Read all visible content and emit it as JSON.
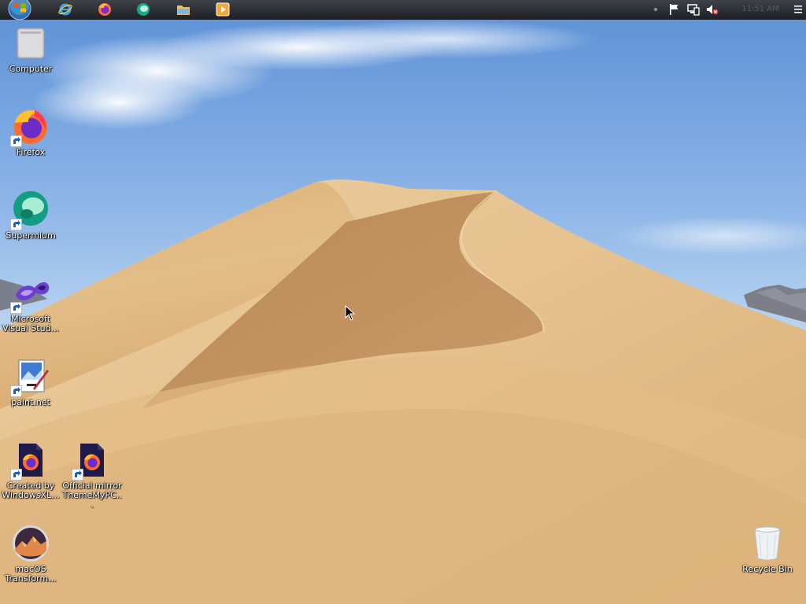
{
  "colors": {
    "sky_top": "#5f93d8",
    "sky_bottom": "#cfe3f4",
    "sand_light": "#e8c99a",
    "sand_mid": "#d4a66c",
    "sand_shadow": "#b8864d",
    "taskbar": "#2b2d33"
  },
  "taskbar": {
    "start_icon": "windows-logo-icon",
    "pinned": [
      {
        "name": "internet-explorer",
        "icon": "internet-explorer-icon"
      },
      {
        "name": "firefox",
        "icon": "firefox-icon"
      },
      {
        "name": "supermium",
        "icon": "supermium-icon"
      },
      {
        "name": "file-explorer",
        "icon": "folder-icon"
      },
      {
        "name": "media-player",
        "icon": "media-player-icon"
      }
    ],
    "tray": [
      "action-center-flag-icon",
      "network-icon",
      "volume-muted-icon"
    ],
    "clock": "11:51 AM"
  },
  "desktop": {
    "icons": [
      {
        "label": "Computer",
        "icon": "computer-icon",
        "shortcut": false
      },
      {
        "label": "Firefox",
        "icon": "firefox-icon",
        "shortcut": true
      },
      {
        "label": "Supermium",
        "icon": "supermium-icon",
        "shortcut": true
      },
      {
        "label": "Microsoft Visual Stud...",
        "icon": "visual-studio-icon",
        "shortcut": true
      },
      {
        "label": "paint.net",
        "icon": "paint-net-icon",
        "shortcut": true
      },
      {
        "label": "Created by WindowsXL...",
        "icon": "firefox-file-icon",
        "shortcut": true
      },
      {
        "label": "Official mirror ThemeMyPC...",
        "icon": "firefox-file-icon",
        "shortcut": true
      },
      {
        "label": "macOS Transform...",
        "icon": "macos-transformation-icon",
        "shortcut": false
      },
      {
        "label": "Recycle Bin",
        "icon": "recycle-bin-icon",
        "shortcut": false
      }
    ]
  }
}
